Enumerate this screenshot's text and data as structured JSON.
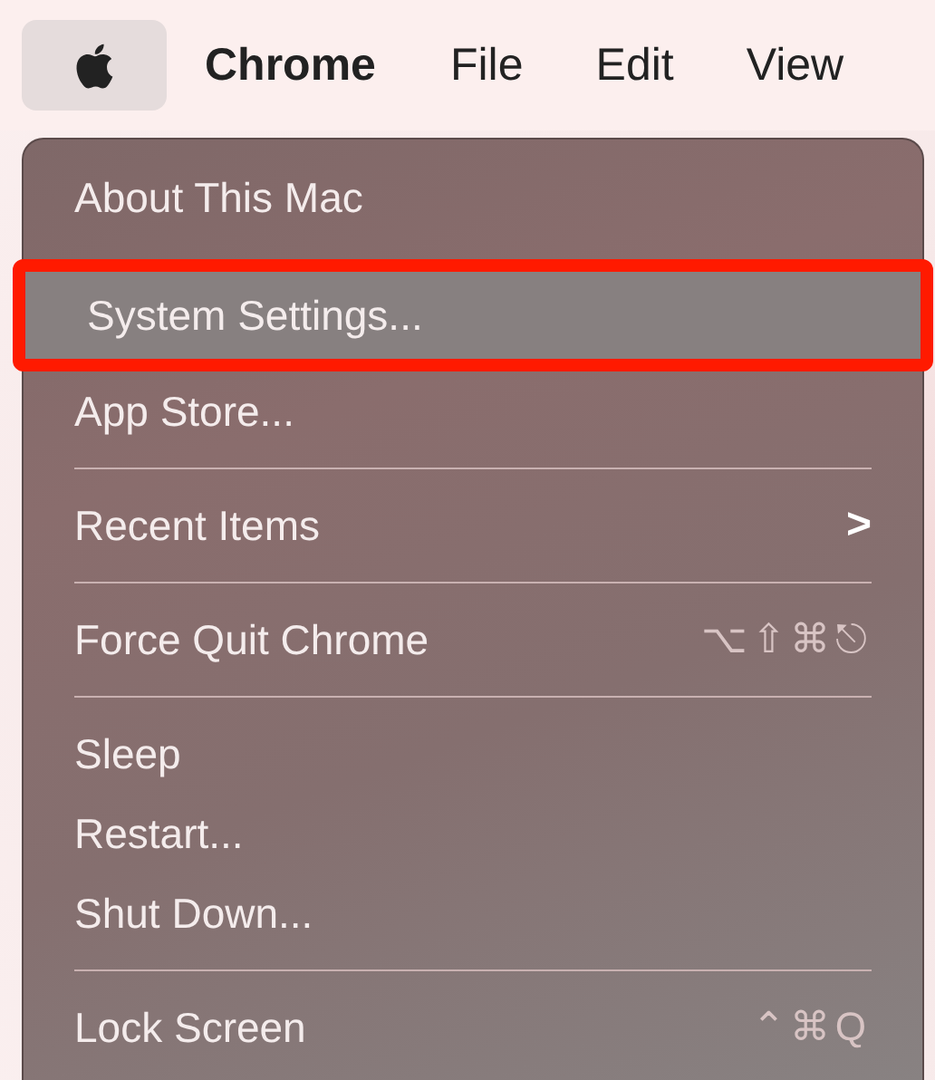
{
  "menu_bar": {
    "items": [
      {
        "kind": "apple",
        "selected": true
      },
      {
        "kind": "app",
        "label": "Chrome",
        "selected": false
      },
      {
        "kind": "menu",
        "label": "File",
        "selected": false
      },
      {
        "kind": "menu",
        "label": "Edit",
        "selected": false
      },
      {
        "kind": "menu",
        "label": "View",
        "selected": false
      }
    ]
  },
  "apple_menu": {
    "items": [
      {
        "kind": "item",
        "label": "About This Mac",
        "highlighted": false
      },
      {
        "kind": "item",
        "label": "System Settings...",
        "highlighted": true
      },
      {
        "kind": "item",
        "label": "App Store...",
        "highlighted": false
      },
      {
        "kind": "separator"
      },
      {
        "kind": "submenu",
        "label": "Recent Items",
        "arrow": ">",
        "highlighted": false
      },
      {
        "kind": "separator"
      },
      {
        "kind": "item",
        "label": "Force Quit Chrome",
        "shortcut": "⌥⇧⌘⎋",
        "highlighted": false
      },
      {
        "kind": "separator"
      },
      {
        "kind": "item",
        "label": "Sleep",
        "highlighted": false
      },
      {
        "kind": "item",
        "label": "Restart...",
        "highlighted": false
      },
      {
        "kind": "item",
        "label": "Shut Down...",
        "highlighted": false
      },
      {
        "kind": "separator"
      },
      {
        "kind": "item",
        "label": "Lock Screen",
        "shortcut": "⌃⌘Q",
        "highlighted": false
      }
    ]
  }
}
